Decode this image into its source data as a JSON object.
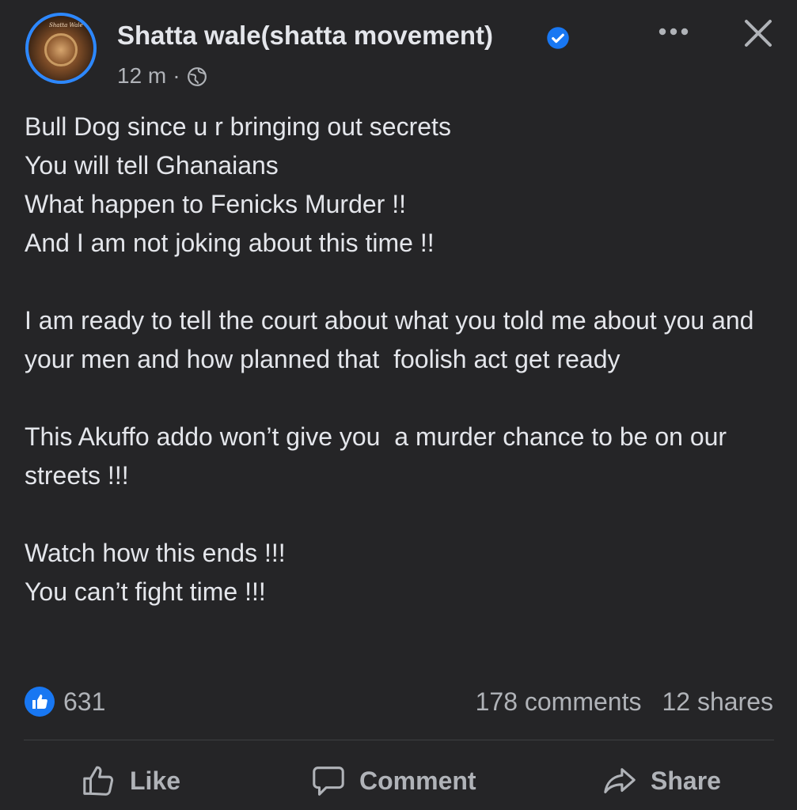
{
  "post": {
    "author": "Shatta wale(shatta movement)",
    "avatar_text": "Shatta Wale",
    "time": "12 m",
    "separator": "·",
    "privacy_icon": "globe-icon",
    "verified_icon": "verified-badge-icon",
    "more_icon": "more-options-icon",
    "close_icon": "close-icon",
    "body": "Bull Dog since u r bringing out secrets\nYou will tell Ghanaians\nWhat happen to Fenicks Murder !!\nAnd I am not joking about this time !!\n\nI am ready to tell the court about what you told me about you and your men and how planned that  foolish act get ready\n\nThis Akuffo addo won’t give you  a murder chance to be on our streets !!!\n\nWatch how this ends !!!\nYou can’t fight time !!!"
  },
  "stats": {
    "reaction_icon": "like-reaction-icon",
    "likes": "631",
    "comments": "178 comments",
    "shares": "12 shares"
  },
  "actions": {
    "like_label": "Like",
    "comment_label": "Comment",
    "share_label": "Share"
  },
  "colors": {
    "background": "#252527",
    "accent": "#1877f2",
    "avatar_ring": "#2d88ff",
    "text_primary": "#e4e6eb",
    "text_secondary": "#b0b3b8"
  }
}
